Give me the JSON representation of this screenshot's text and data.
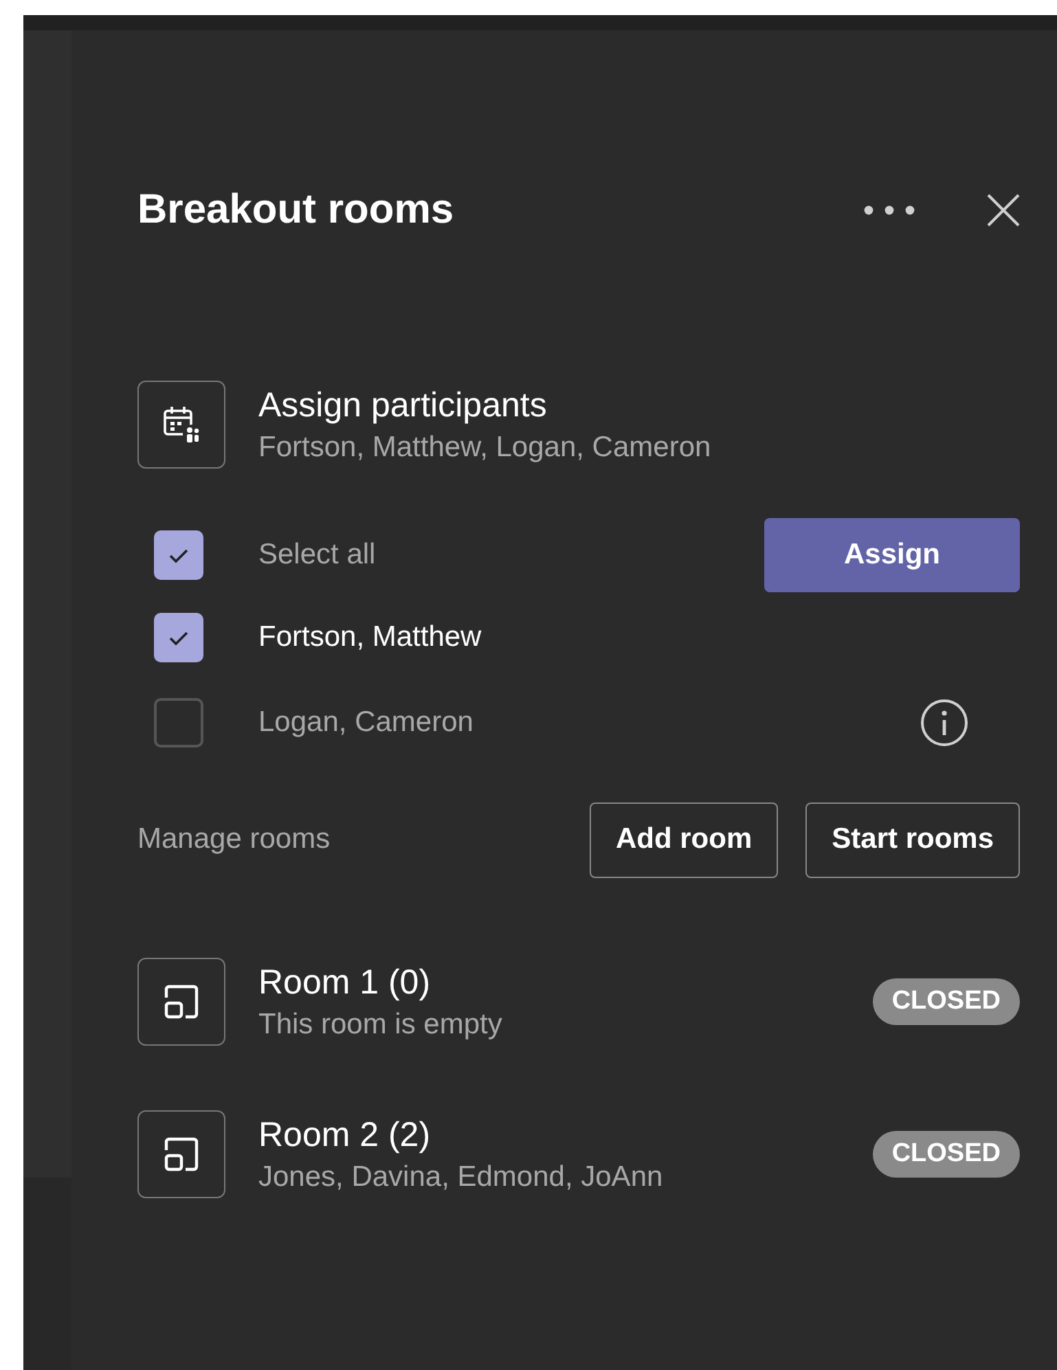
{
  "panel": {
    "title": "Breakout rooms"
  },
  "assign": {
    "title": "Assign participants",
    "subtitle": "Fortson, Matthew, Logan, Cameron",
    "select_all": {
      "label": "Select all",
      "checked": true
    },
    "button": "Assign",
    "participants": [
      {
        "name": "Fortson, Matthew",
        "checked": true,
        "info": false
      },
      {
        "name": "Logan, Cameron",
        "checked": false,
        "info": true
      }
    ]
  },
  "manage": {
    "label": "Manage rooms",
    "buttons": [
      "Add room",
      "Start rooms"
    ]
  },
  "rooms": [
    {
      "name": "Room 1 (0)",
      "detail": "This room is empty",
      "status": "CLOSED"
    },
    {
      "name": "Room 2 (2)",
      "detail": "Jones, Davina, Edmond, JoAnn",
      "status": "CLOSED"
    }
  ]
}
